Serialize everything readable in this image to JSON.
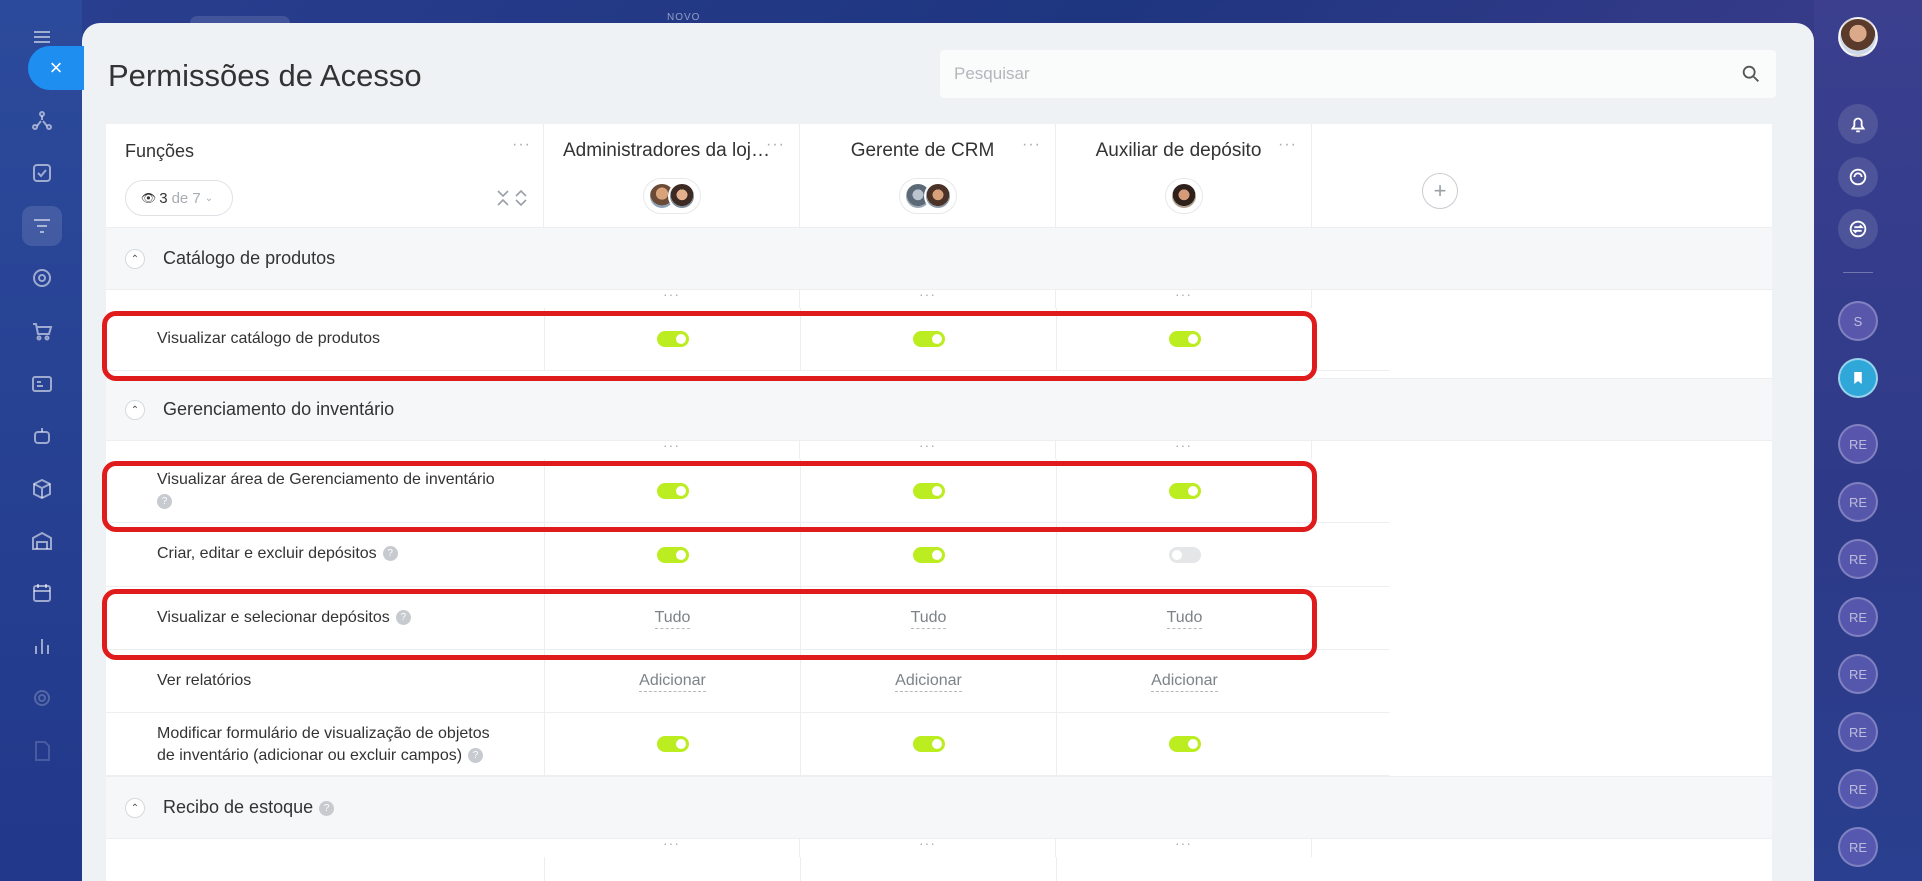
{
  "top_label": "NOVO",
  "close_label": "×",
  "page": {
    "title": "Permissões de Acesso",
    "search_placeholder": "Pesquisar"
  },
  "columns": {
    "funcoes_label": "Funções",
    "view_count": "3",
    "view_total": "de 7",
    "roles": [
      {
        "label": "Administradores da loj…",
        "avatars": 2
      },
      {
        "label": "Gerente de CRM",
        "avatars": 2
      },
      {
        "label": "Auxiliar de depósito",
        "avatars": 1
      }
    ],
    "add_label": "+"
  },
  "sections": [
    {
      "label": "Catálogo de produtos",
      "rows": [
        {
          "label": "Visualizar catálogo de produtos",
          "type": "toggle",
          "values": [
            true,
            true,
            true
          ],
          "highlighted": true
        }
      ]
    },
    {
      "label": "Gerenciamento do inventário",
      "rows": [
        {
          "label": "Visualizar área de Gerenciamento de inventário",
          "type": "toggle",
          "values": [
            true,
            true,
            true
          ],
          "highlighted": true
        },
        {
          "label": "Criar, editar e excluir depósitos",
          "type": "toggle",
          "values": [
            true,
            true,
            false
          ]
        },
        {
          "label": "Visualizar e selecionar depósitos",
          "type": "text",
          "values": [
            "Tudo",
            "Tudo",
            "Tudo"
          ],
          "highlighted": true
        },
        {
          "label": "Ver relatórios",
          "type": "text",
          "values": [
            "Adicionar",
            "Adicionar",
            "Adicionar"
          ]
        },
        {
          "label_line1": "Modificar formulário de visualização de objetos",
          "label_line2": "de inventário (adicionar ou excluir campos)",
          "type": "toggle",
          "values": [
            true,
            true,
            true
          ]
        }
      ]
    },
    {
      "label": "Recibo de estoque",
      "rows": []
    }
  ],
  "right_rail": {
    "avatar_letter": "S",
    "initials": "RE"
  },
  "colors": {
    "toggle_on": "#bbed21",
    "toggle_off": "#e4e6e8",
    "highlight": "#e01b1b",
    "accent": "#1f8ef1"
  }
}
